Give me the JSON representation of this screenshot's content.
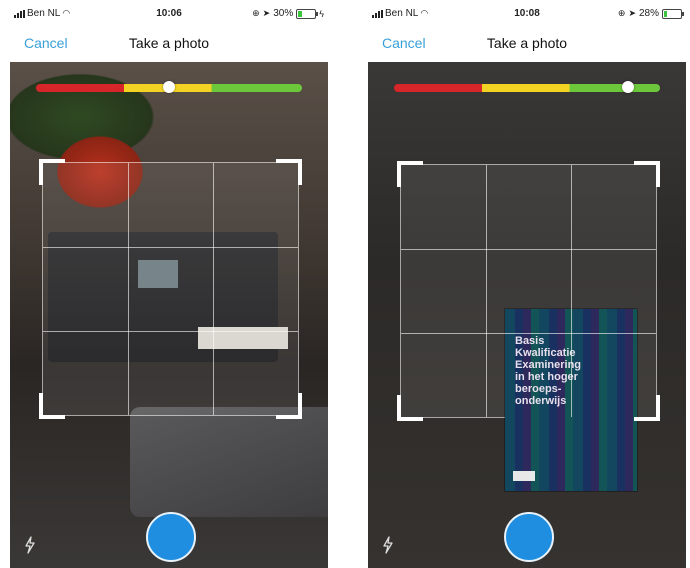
{
  "screens": [
    {
      "status": {
        "carrier": "Ben NL",
        "time": "10:06",
        "battery": "30%",
        "battery_level": 0.3,
        "charging_glyph": "ϟ"
      },
      "nav": {
        "cancel": "Cancel",
        "title": "Take a photo"
      },
      "quality_level": 0.5,
      "icons": {
        "location": "➤",
        "alarm": "⊕",
        "wifi": "◠",
        "flash": "flash-icon"
      }
    },
    {
      "status": {
        "carrier": "Ben NL",
        "time": "10:08",
        "battery": "28%",
        "battery_level": 0.28
      },
      "nav": {
        "cancel": "Cancel",
        "title": "Take a photo"
      },
      "quality_level": 0.88,
      "book": {
        "title": "Basis\nKwalificatie\nExaminering\nin het hoger\nberoeps-\nonderwijs"
      },
      "icons": {
        "location": "➤",
        "alarm": "⊕",
        "wifi": "◠",
        "flash": "flash-icon"
      }
    }
  ],
  "colors": {
    "accent": "#3aa0d8",
    "shutter": "#1f8ee0",
    "quality_red": "#d7262a",
    "quality_yellow": "#f2d324",
    "quality_green": "#6cc83a"
  }
}
